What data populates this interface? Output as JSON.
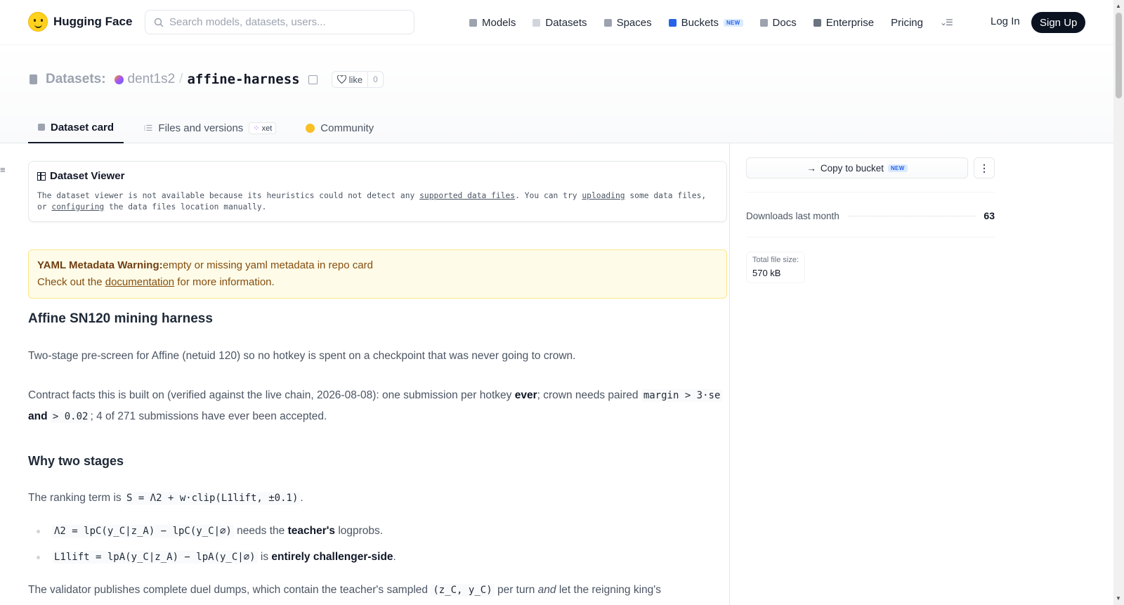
{
  "brand": {
    "name": "Hugging Face"
  },
  "search": {
    "placeholder": "Search models, datasets, users..."
  },
  "nav": {
    "items": [
      {
        "label": "Models",
        "color": "#9ca3af"
      },
      {
        "label": "Datasets",
        "color": "#d1d5db"
      },
      {
        "label": "Spaces",
        "color": "#9ca3af"
      },
      {
        "label": "Buckets",
        "badge": "NEW",
        "color": "#2563eb"
      },
      {
        "label": "Docs",
        "color": "#9ca3af"
      },
      {
        "label": "Enterprise",
        "color": "#6b7280"
      },
      {
        "label": "Pricing"
      }
    ],
    "login": "Log In",
    "signup": "Sign Up"
  },
  "repo": {
    "type_label": "Datasets:",
    "owner": "dent1s2",
    "name": "affine-harness",
    "like_label": "like",
    "like_count": "0"
  },
  "tabs": [
    {
      "label": "Dataset card",
      "active": true
    },
    {
      "label": "Files and versions",
      "badge": "xet"
    },
    {
      "label": "Community"
    }
  ],
  "viewer": {
    "title": "Dataset Viewer",
    "msg_1": "The dataset viewer is not available because its heuristics could not detect any ",
    "link_1": "supported data files",
    "msg_2": ". You can try ",
    "link_2": "uploading",
    "msg_3": " some data files, or ",
    "link_3": "configuring",
    "msg_4": " the data files location manually."
  },
  "warning": {
    "title": "YAML Metadata Warning:",
    "text": "empty or missing yaml metadata in repo card",
    "line2_pre": "Check out the ",
    "link": "documentation",
    "line2_post": " for more information."
  },
  "card": {
    "h1": "Affine SN120 mining harness",
    "p1": "Two-stage pre-screen for Affine (netuid 120) so no hotkey is spent on a checkpoint that was never going to crown.",
    "p2_a": "Contract facts this is built on (verified against the live chain, 2026-08-08): one submission per hotkey ",
    "p2_b": "ever",
    "p2_c": "; crown needs paired ",
    "p2_code1": "margin > 3·se",
    "p2_d": " and ",
    "p2_code2": "> 0.02",
    "p2_e": "; 4 of 271 submissions have ever been accepted.",
    "h2": "Why two stages",
    "p3_a": "The ranking term is ",
    "p3_code": "S = Λ2 + w·clip(L1lift, ±0.1)",
    "p3_b": ".",
    "li1_code": "Λ2 = lpC(y_C|z_A) − lpC(y_C|∅)",
    "li1_a": " needs the ",
    "li1_b": "teacher's",
    "li1_c": " logprobs.",
    "li2_code": "L1lift = lpA(y_C|z_A) − lpA(y_C|∅)",
    "li2_a": " is ",
    "li2_b": "entirely challenger-side",
    "li2_c": ".",
    "p4_a": "The validator publishes complete duel dumps, which contain the teacher's sampled ",
    "p4_code": "(z_C, y_C)",
    "p4_b": " per turn ",
    "p4_c": "and",
    "p4_d": " let the reigning king's"
  },
  "sidebar": {
    "copy_bucket": "Copy to bucket",
    "copy_bucket_badge": "NEW",
    "downloads_label": "Downloads last month",
    "downloads_value": "63",
    "filesize_label": "Total file size:",
    "filesize_value": "570 kB"
  }
}
